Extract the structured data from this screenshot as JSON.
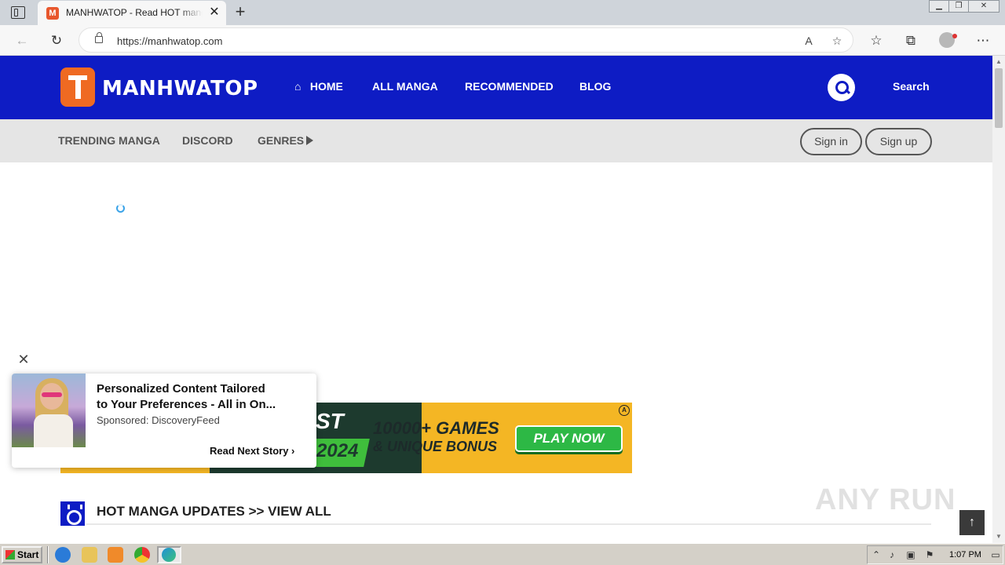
{
  "browser": {
    "tab_title": "MANHWATOP - Read HOT manga",
    "tab_favicon": "M",
    "url": "https://manhwatop.com",
    "tab_close": "✕",
    "new_tab": "+",
    "icons": [
      "tab-actions-icon",
      "back-icon",
      "refresh-icon",
      "lock-icon",
      "read-aloud-icon",
      "add-favorite-icon",
      "favorites-icon",
      "collections-icon",
      "profile-icon",
      "more-icon"
    ]
  },
  "site": {
    "logo_text": "MANHWATOP",
    "nav": {
      "home": "HOME",
      "all_manga": "ALL MANGA",
      "recommended": "RECOMMENDED",
      "blog": "BLOG"
    },
    "search_label": "Search",
    "subnav": {
      "trending": "TRENDING MANGA",
      "discord": "DISCORD",
      "genres": "GENRES"
    },
    "auth": {
      "sign_in": "Sign in",
      "sign_up": "Sign up"
    },
    "section_title": "HOT MANGA UPDATES >> VIEW ALL",
    "brand_color": "#0e1cc4"
  },
  "banner_ad": {
    "fragment_top": "ST",
    "fragment_year": "2024",
    "headline_1": "10000+ GAMES",
    "headline_2": "& UNIQUE BONUS",
    "cta": "PLAY NOW",
    "ad_choice": "A"
  },
  "popup_ad": {
    "headline_line1": "Personalized Content Tailored",
    "headline_line2": "to Your Preferences - All in On...",
    "sponsor": "Sponsored: DiscoveryFeed",
    "cta": "Read Next Story",
    "close": "✕"
  },
  "watermark": "ANY RUN",
  "taskbar": {
    "start_label": "Start",
    "clock": "1:07 PM",
    "apps": [
      "internet-explorer-icon",
      "file-explorer-icon",
      "media-player-icon",
      "chrome-icon",
      "edge-icon"
    ]
  }
}
